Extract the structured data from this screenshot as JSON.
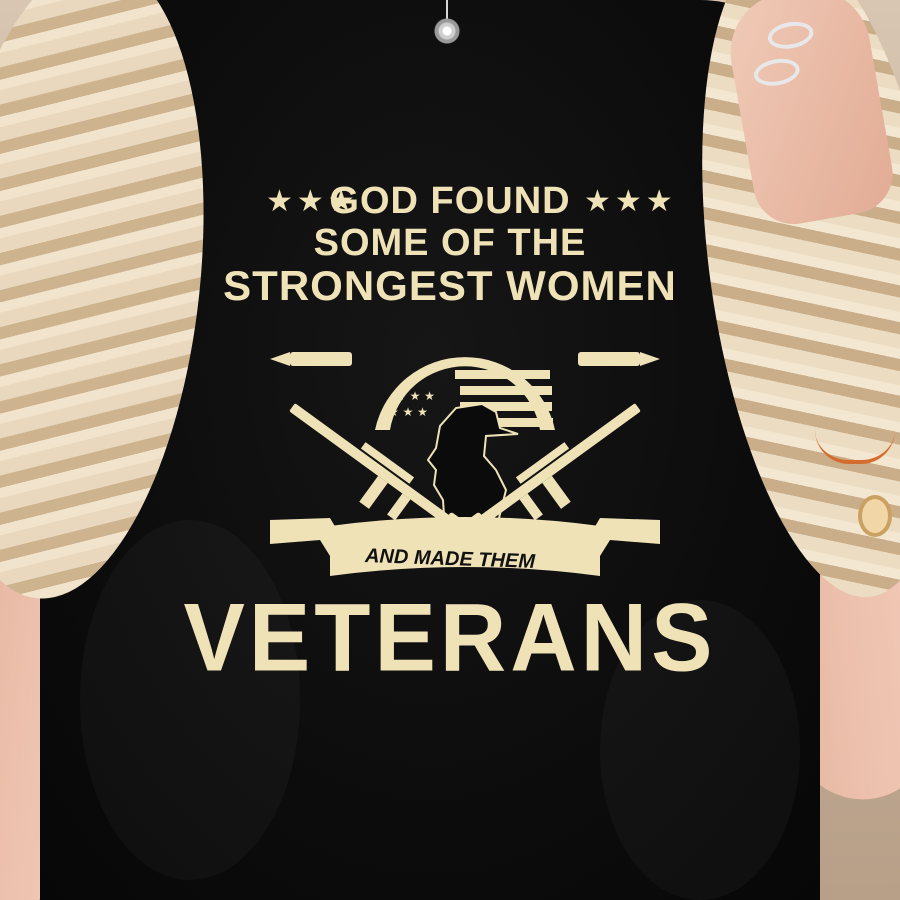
{
  "design": {
    "headline_line1": "GOD FOUND",
    "headline_line2": "SOME OF THE",
    "headline_line3": "STRONGEST WOMEN",
    "ribbon_text": "AND MADE THEM",
    "big_word": "VETERANS",
    "stars_left": "★★★",
    "stars_right": "★★★"
  },
  "colors": {
    "shirt": "#0d0d0d",
    "print": "#efe2b7",
    "skin": "#e7b8a3",
    "hair": "#e9d8bd"
  },
  "icons": [
    "star-icon",
    "bullet-icon",
    "rifle-icon",
    "woman-silhouette-icon",
    "flag-icon",
    "ribbon-banner"
  ]
}
